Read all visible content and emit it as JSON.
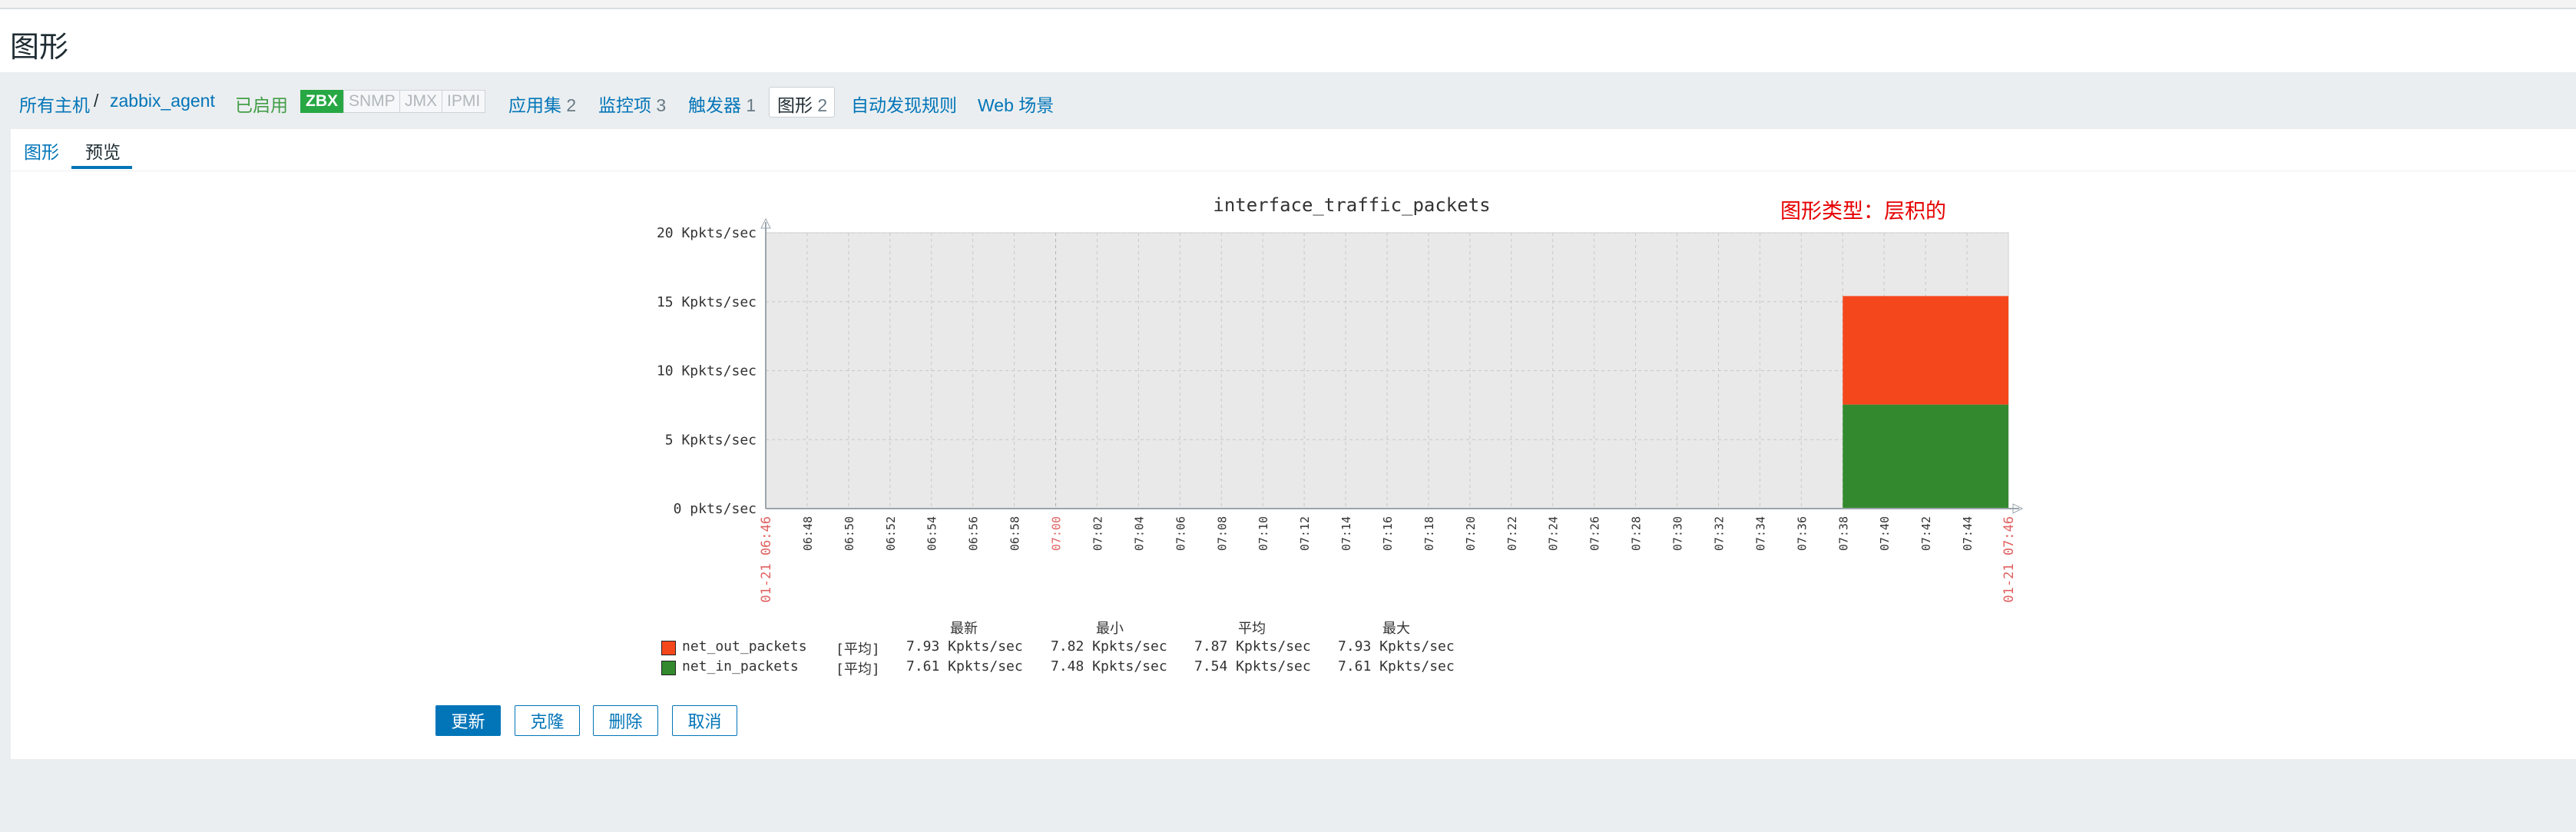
{
  "page": {
    "title": "图形"
  },
  "breadcrumb": {
    "all_hosts": "所有主机",
    "separator": "/",
    "host": "zabbix_agent",
    "status": "已启用",
    "tags": [
      "ZBX",
      "SNMP",
      "JMX",
      "IPMI"
    ],
    "links": [
      {
        "label": "应用集",
        "count": "2"
      },
      {
        "label": "监控项",
        "count": "3"
      },
      {
        "label": "触发器",
        "count": "1"
      },
      {
        "label": "图形",
        "count": "2"
      },
      {
        "label": "自动发现规则",
        "count": ""
      },
      {
        "label": "Web 场景",
        "count": ""
      }
    ]
  },
  "tabs": {
    "graph": "图形",
    "preview": "预览"
  },
  "annotation": "图形类型：层积的",
  "chart_data": {
    "type": "area",
    "stacked": true,
    "title": "interface_traffic_packets",
    "y_ticks": [
      "20 Kpkts/sec",
      "15 Kpkts/sec",
      "10 Kpkts/sec",
      "5 Kpkts/sec",
      "0 pkts/sec"
    ],
    "ylim": [
      0,
      20
    ],
    "x_ticks": [
      "06:48",
      "06:50",
      "06:52",
      "06:54",
      "06:56",
      "06:58",
      "07:00",
      "07:02",
      "07:04",
      "07:06",
      "07:08",
      "07:10",
      "07:12",
      "07:14",
      "07:16",
      "07:18",
      "07:20",
      "07:22",
      "07:24",
      "07:26",
      "07:28",
      "07:30",
      "07:32",
      "07:34",
      "07:36",
      "07:38",
      "07:40",
      "07:42",
      "07:44"
    ],
    "x_start_label": "01-21 06:46",
    "x_end_label": "01-21 07:46",
    "series": [
      {
        "name": "net_in_packets",
        "color": "#338a2e",
        "x": [
          "07:38",
          "07:46"
        ],
        "values": [
          7.54,
          7.54
        ]
      },
      {
        "name": "net_out_packets",
        "color": "#f5471c",
        "x": [
          "07:38",
          "07:46"
        ],
        "values": [
          7.87,
          7.87
        ]
      }
    ],
    "grid": true
  },
  "legend": {
    "headers": {
      "latest": "最新",
      "min": "最小",
      "avg": "平均",
      "max": "最大"
    },
    "rows": [
      {
        "name": "net_out_packets",
        "func": "[平均]",
        "latest": "7.93 Kpkts/sec",
        "min": "7.82 Kpkts/sec",
        "avg": "7.87 Kpkts/sec",
        "max": "7.93 Kpkts/sec",
        "color": "#f5471c"
      },
      {
        "name": "net_in_packets",
        "func": "[平均]",
        "latest": "7.61 Kpkts/sec",
        "min": "7.48 Kpkts/sec",
        "avg": "7.54 Kpkts/sec",
        "max": "7.61 Kpkts/sec",
        "color": "#338a2e"
      }
    ]
  },
  "buttons": {
    "update": "更新",
    "clone": "克隆",
    "delete": "删除",
    "cancel": "取消"
  }
}
